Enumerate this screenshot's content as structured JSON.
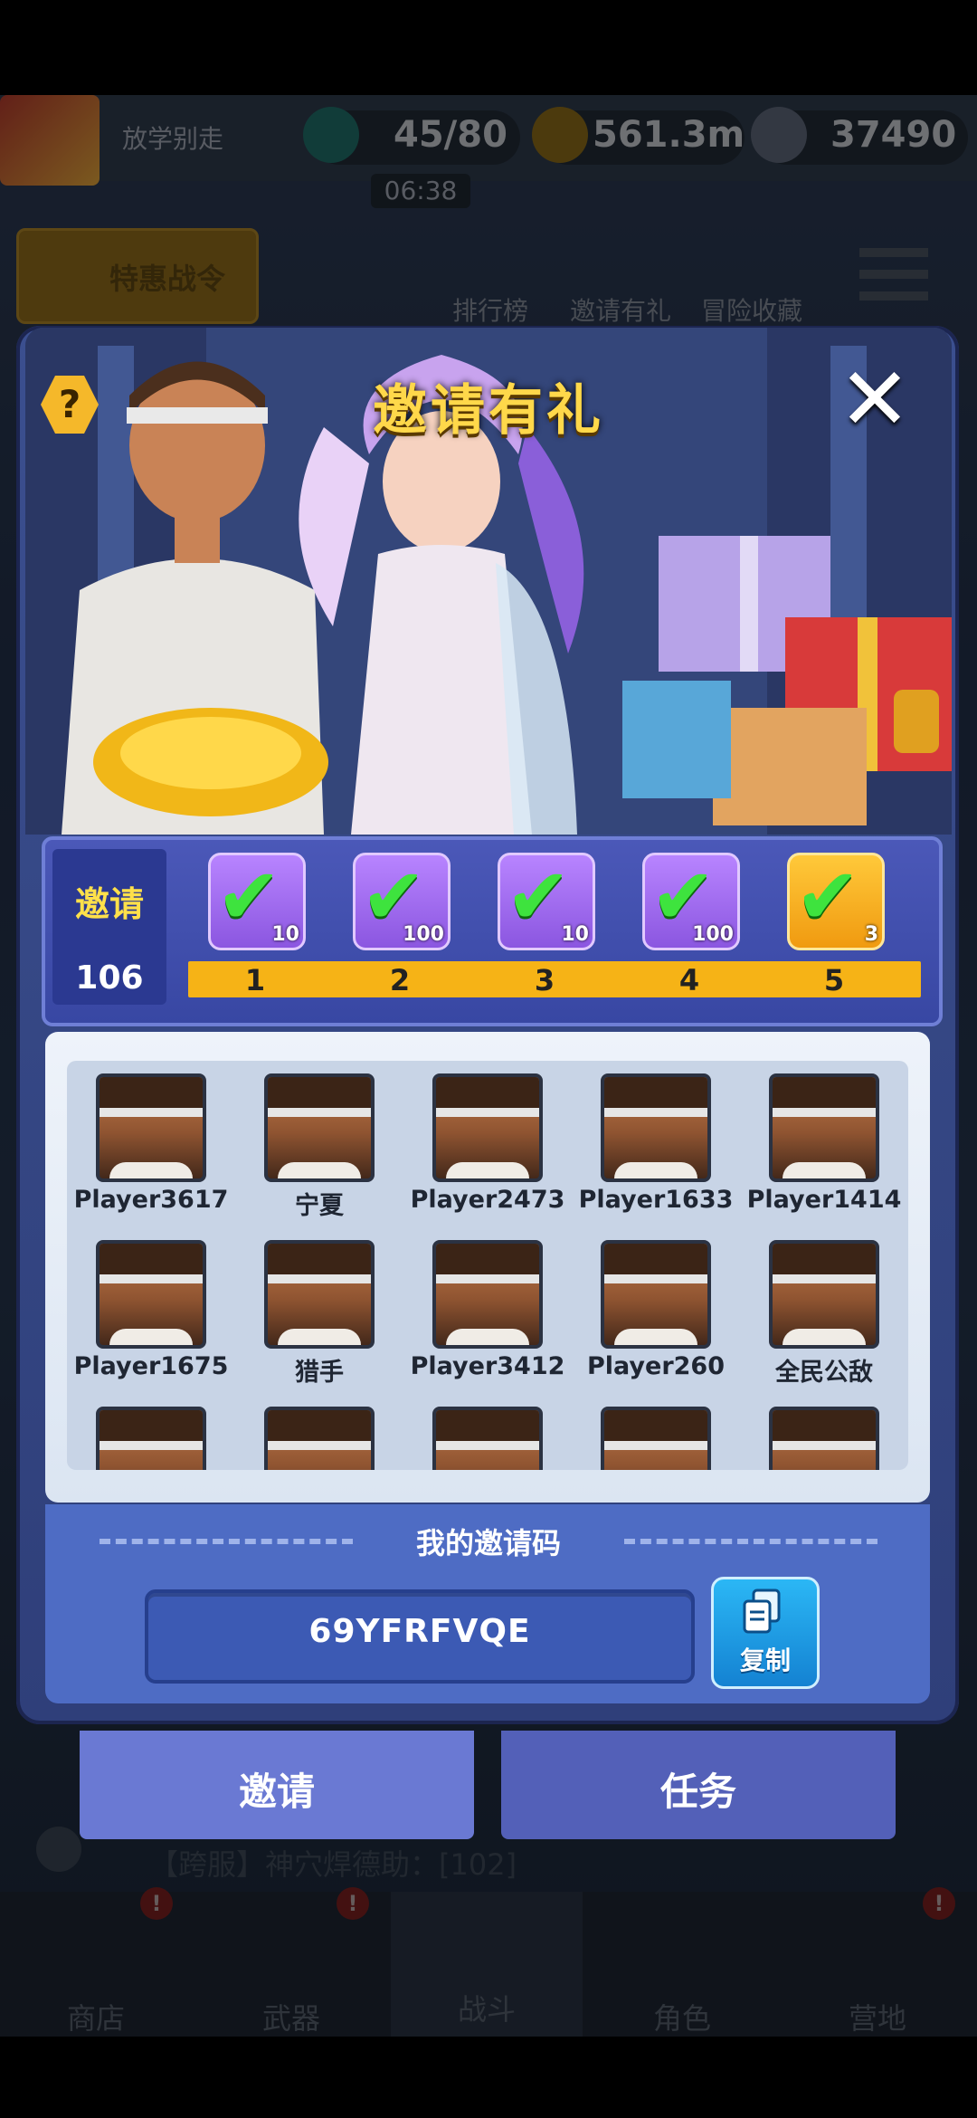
{
  "topbar": {
    "player_title": "放学别走",
    "energy": "45/80",
    "timer": "06:38",
    "coins": "561.3m",
    "gems": "37490"
  },
  "side_buttons": {
    "battle_pass": "特惠战令",
    "leaderboard": "排行榜",
    "invite": "邀请有礼",
    "collection": "冒险收藏"
  },
  "chat": {
    "line": "【跨服】神穴焊德助：[102]"
  },
  "bottom_nav": [
    {
      "label": "商店",
      "badge": "!"
    },
    {
      "label": "武器",
      "badge": "!"
    },
    {
      "label": "战斗",
      "badge": ""
    },
    {
      "label": "角色",
      "badge": ""
    },
    {
      "label": "营地",
      "badge": "!"
    }
  ],
  "modal": {
    "title": "邀请有礼",
    "help": "?",
    "close": "✕",
    "progress": {
      "label": "邀请",
      "count": "106",
      "milestones": [
        {
          "step": "1",
          "qty": "10",
          "claimed": true,
          "reward": "energy"
        },
        {
          "step": "2",
          "qty": "100",
          "claimed": true,
          "reward": "gem"
        },
        {
          "step": "3",
          "qty": "10",
          "claimed": true,
          "reward": "energy"
        },
        {
          "step": "4",
          "qty": "100",
          "claimed": true,
          "reward": "gem"
        },
        {
          "step": "5",
          "qty": "3",
          "claimed": true,
          "reward": "ticket"
        }
      ]
    },
    "players": [
      "Player3617",
      "宁夏",
      "Player2473",
      "Player1633",
      "Player1414",
      "Player1675",
      "猎手",
      "Player3412",
      "Player260",
      "全民公敌"
    ],
    "invite_code": {
      "title": "我的邀请码",
      "code": "69YFRFVQE",
      "copy_label": "复制"
    },
    "tabs": {
      "invite": "邀请",
      "tasks": "任务"
    }
  },
  "colors": {
    "title": "#ffd84a",
    "check": "#3ee33e",
    "track": "#f6b316",
    "panel": "#3847a3"
  }
}
